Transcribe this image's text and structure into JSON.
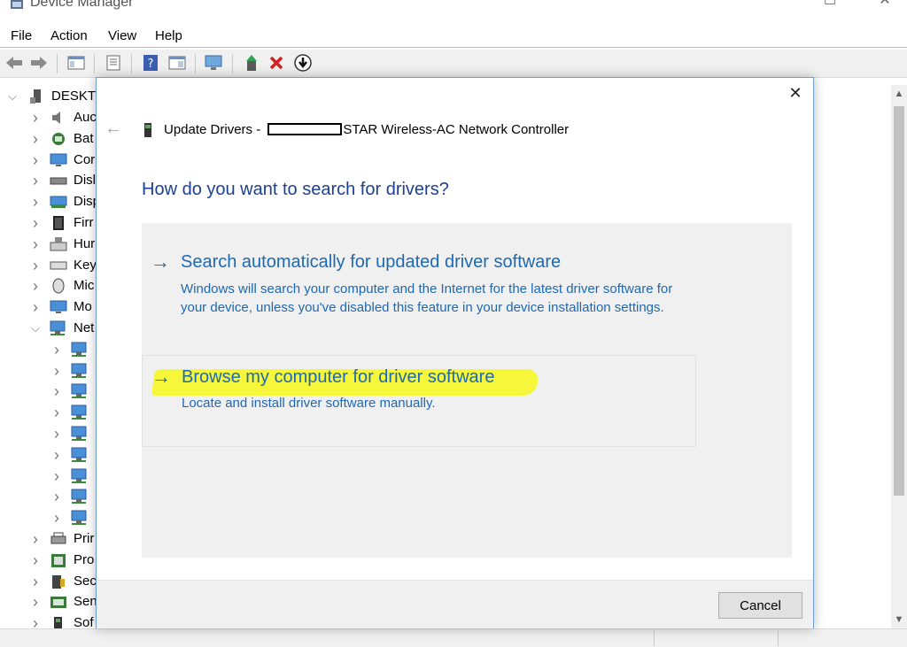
{
  "window": {
    "title": "Device Manager",
    "controls": {
      "minimize": "—",
      "maximize": "☐",
      "close": "✕"
    }
  },
  "menu": [
    "File",
    "Action",
    "View",
    "Help"
  ],
  "tree": {
    "root": "DESKTO",
    "items": [
      {
        "label": "Auc",
        "icon": "speaker-icon",
        "expanded": false
      },
      {
        "label": "Bat",
        "icon": "battery-icon",
        "expanded": false
      },
      {
        "label": "Cor",
        "icon": "monitor-icon",
        "expanded": false
      },
      {
        "label": "Disl",
        "icon": "disk-drive-icon",
        "expanded": false
      },
      {
        "label": "Disp",
        "icon": "display-adapter-icon",
        "expanded": false
      },
      {
        "label": "Firr",
        "icon": "firmware-chip-icon",
        "expanded": false
      },
      {
        "label": "Hur",
        "icon": "hid-keyboard-icon",
        "expanded": false
      },
      {
        "label": "Key",
        "icon": "keyboard-icon",
        "expanded": false
      },
      {
        "label": "Mic",
        "icon": "mouse-icon",
        "expanded": false
      },
      {
        "label": "Mo",
        "icon": "monitor-icon",
        "expanded": false
      },
      {
        "label": "Net",
        "icon": "network-icon",
        "expanded": true
      },
      {
        "label": "Prir",
        "icon": "printer-icon",
        "expanded": false
      },
      {
        "label": "Pro",
        "icon": "processor-icon",
        "expanded": false
      },
      {
        "label": "Sec",
        "icon": "security-device-icon",
        "expanded": false
      },
      {
        "label": "Sen",
        "icon": "sensor-icon",
        "expanded": false
      },
      {
        "label": "Sof",
        "icon": "software-device-icon",
        "expanded": false
      }
    ],
    "network_children_count": 9
  },
  "dialog": {
    "title_prefix": "Update Drivers - ",
    "title_suffix": "STAR Wireless-AC Network Controller",
    "heading": "How do you want to search for drivers?",
    "options": [
      {
        "title": "Search automatically for updated driver software",
        "description": "Windows will search your computer and the Internet for the latest driver software for your device, unless you've disabled this feature in your device installation settings."
      },
      {
        "title": "Browse my computer for driver software",
        "description": "Locate and install driver software manually.",
        "highlighted": true
      }
    ],
    "cancel_label": "Cancel",
    "close_glyph": "✕",
    "back_glyph": "←",
    "arrow_glyph": "→"
  },
  "colors": {
    "heading": "#1c3f92",
    "link": "#1d6ab3",
    "highlight": "#f6f63a",
    "panel": "#f0f0f0"
  }
}
